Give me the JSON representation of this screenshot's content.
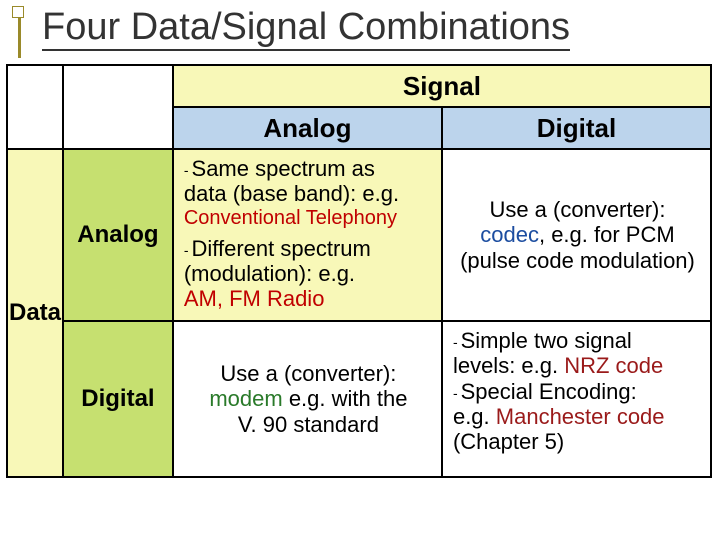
{
  "title": "Four Data/Signal Combinations",
  "headers": {
    "col_group": "Signal",
    "col_a": "Analog",
    "col_b": "Digital",
    "row_group": "Data",
    "row_a": "Analog",
    "row_b": "Digital"
  },
  "cells": {
    "aa": {
      "l1a": "Same spectrum as",
      "l1b": "data (base band): e.g.",
      "l1c": "Conventional Telephony",
      "l2a": "Different spectrum",
      "l2b": "(modulation): e.g.",
      "l2c": "AM, FM Radio"
    },
    "ab": {
      "l1": "Use a (converter):",
      "l2a": "codec",
      "l2b": ", e.g. for PCM",
      "l3": "(pulse code modulation)"
    },
    "ba": {
      "l1": "Use a (converter):",
      "l2a": "modem",
      "l2b": " e.g. with the",
      "l3": "V. 90 standard"
    },
    "bb": {
      "l1a": "Simple two signal",
      "l1b": "levels: e.g. ",
      "l1c": "NRZ code",
      "l2a": "Special Encoding:",
      "l2b": "e.g. ",
      "l2c": "Manchester code",
      "l3": "(Chapter 5)"
    }
  },
  "glyph": {
    "dash": "-"
  }
}
